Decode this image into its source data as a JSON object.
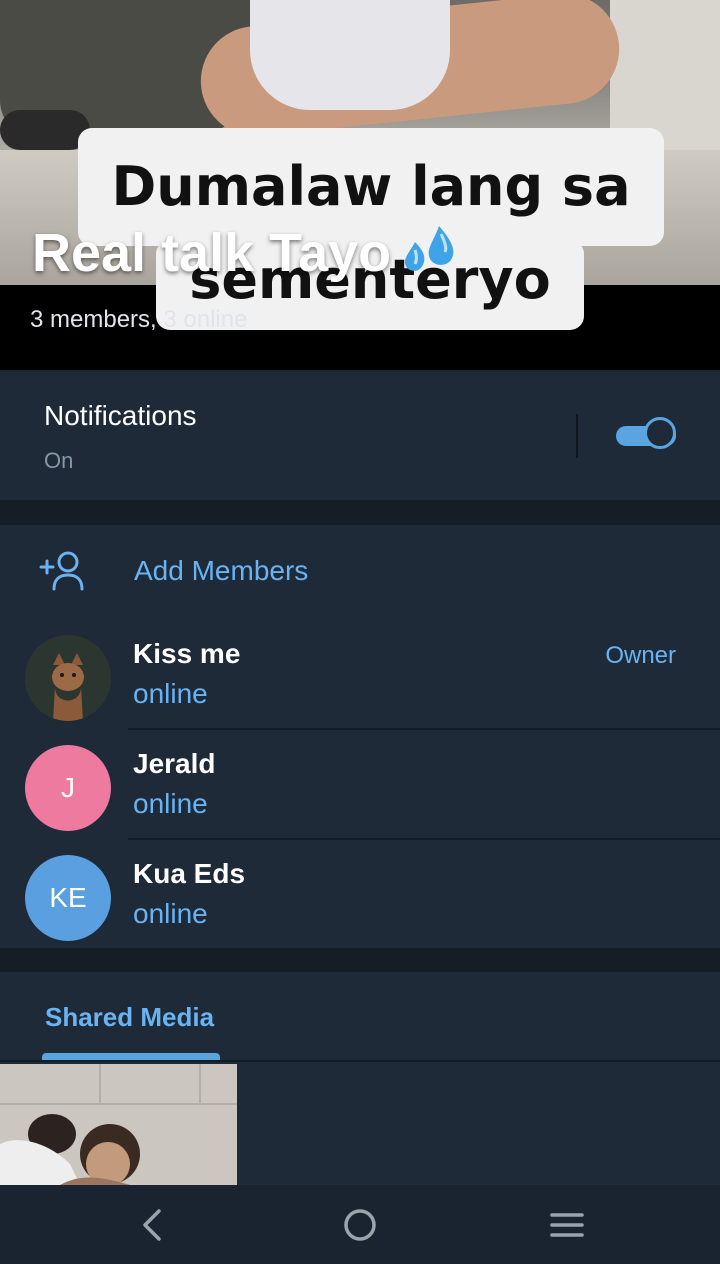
{
  "header": {
    "photo_sticker_line1": "Dumalaw lang sa",
    "photo_sticker_line2": "sementeryo",
    "title": "Real talk Tayo",
    "title_emoji_icon": "sweat-droplets-icon",
    "subtitle": "3 members, 3 online"
  },
  "notifications": {
    "label": "Notifications",
    "value": "On",
    "enabled": true
  },
  "members": {
    "add_label": "Add Members",
    "list": [
      {
        "name": "Kiss me",
        "status": "online",
        "role": "Owner",
        "avatar_initials": "",
        "avatar_color": "#3b4a3e"
      },
      {
        "name": "Jerald",
        "status": "online",
        "role": "",
        "avatar_initials": "J",
        "avatar_color": "#ee7aa0"
      },
      {
        "name": "Kua Eds",
        "status": "online",
        "role": "",
        "avatar_initials": "KE",
        "avatar_color": "#5aa0e0"
      }
    ]
  },
  "shared_media": {
    "tab_label": "Shared Media"
  },
  "colors": {
    "accent": "#6ab3f3",
    "background": "#1e2a38",
    "separator": "#151e27"
  },
  "navbar": {
    "icons": [
      "back-icon",
      "home-icon",
      "recents-icon"
    ]
  }
}
